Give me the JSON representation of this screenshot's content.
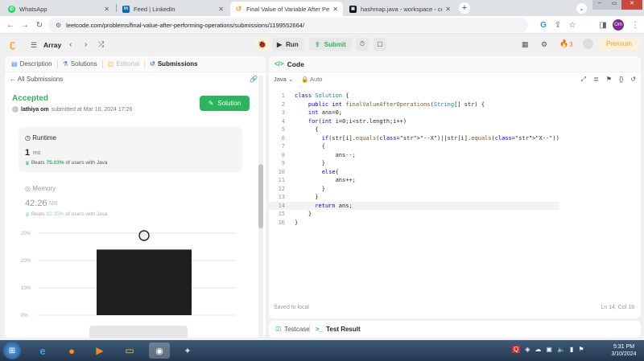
{
  "browser": {
    "tabs": [
      {
        "title": "WhatsApp",
        "favicon": "whatsapp-icon",
        "color": "#25d366"
      },
      {
        "title": "Feed | LinkedIn",
        "favicon": "linkedin-icon",
        "color": "#0a66c2"
      },
      {
        "title": "Final Value of Variable After Performing Operations",
        "favicon": "leetcode-icon",
        "color": "#ffa116"
      },
      {
        "title": "hashmap.java - workspace - codesandbox",
        "favicon": "codesandbox-icon",
        "color": "#151515"
      }
    ],
    "url": "leetcode.com/problems/final-value-after-performing-operations/submissions/1199552664/",
    "profile_initials": "Om"
  },
  "nav": {
    "problem_list": "Array",
    "run": "Run",
    "submit": "Submit",
    "streak": "3",
    "premium": "Premium"
  },
  "left": {
    "tabs": [
      "Description",
      "Solutions",
      "Editorial",
      "Submissions"
    ],
    "back": "All Submissions",
    "status": "Accepted",
    "user": "lathiya om",
    "submitted": "submitted at Mar 10, 2024 17:26",
    "solution_btn": "Solution",
    "runtime": {
      "label": "Runtime",
      "value": "1",
      "unit": "ms",
      "beats_label": "Beats",
      "beats_pct": "75.03%",
      "beats_rest": "of users with Java"
    },
    "memory": {
      "label": "Memory",
      "value": "42.26",
      "unit": "MB",
      "beats_label": "Beats",
      "beats_pct": "92.35%",
      "beats_rest": "of users with Java"
    },
    "chart_data": {
      "type": "bar",
      "ylim": [
        0,
        30
      ],
      "yticks": [
        "20%",
        "20%",
        "10%",
        "0%"
      ],
      "bar_value": 24,
      "selected_marker": true
    }
  },
  "right": {
    "title": "Code",
    "language": "Java",
    "mode": "Auto",
    "saved": "Saved to local",
    "cursor": "Ln 14, Col 18",
    "console_tabs": [
      "Testcase",
      "Test Result"
    ],
    "code_lines": [
      "class Solution {",
      "    public int finalValueAfterOperations(String[] str) {",
      "    int ans=0;",
      "    for(int i=0;i<str.length;i++)",
      "      {",
      "        if(str[i].equals(\"--X\")||str[i].equals(\"X--\"))",
      "        {",
      "            ans--;",
      "        }",
      "        else{",
      "            ans++;",
      "        }",
      "      }",
      "      return ans;",
      "    }",
      "}"
    ]
  },
  "taskbar": {
    "time": "5:31 PM",
    "date": "3/10/2024"
  }
}
